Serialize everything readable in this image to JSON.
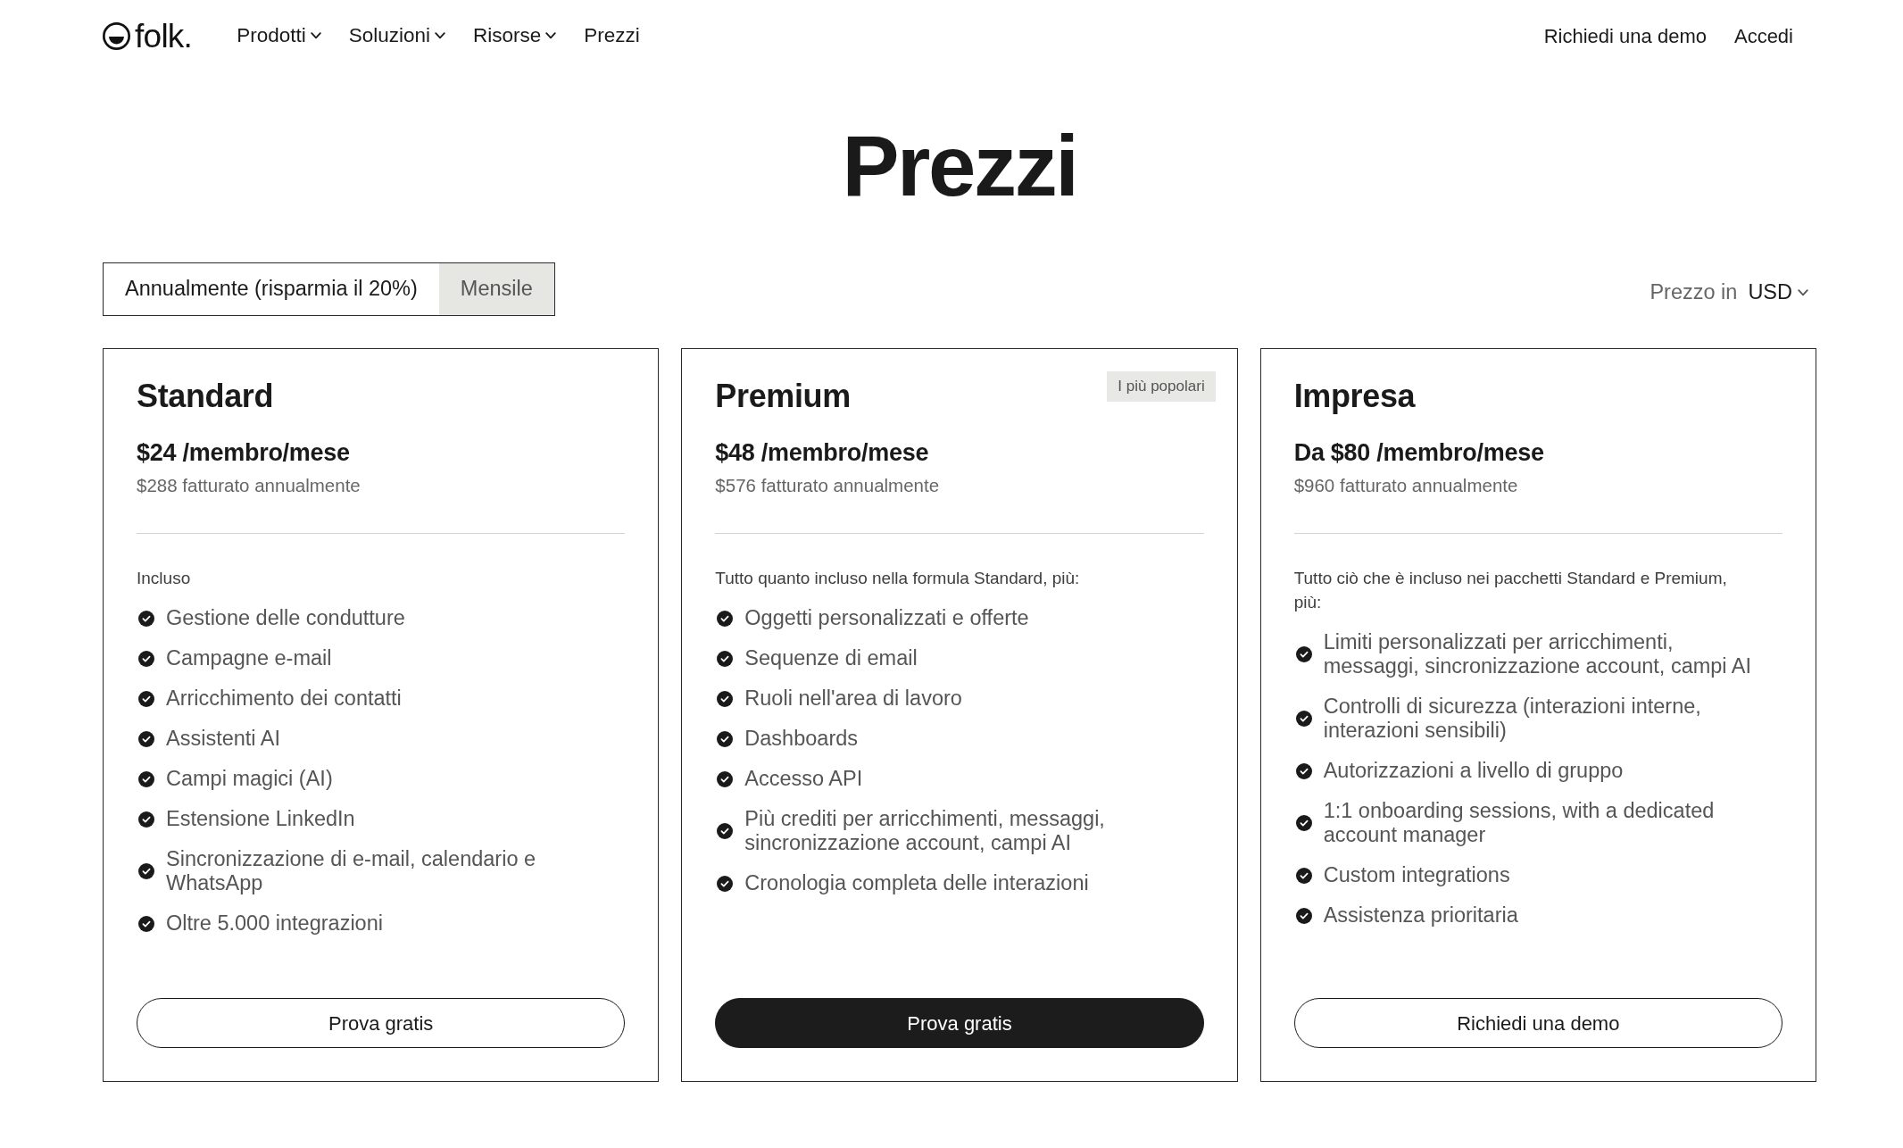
{
  "header": {
    "logo": "folk.",
    "nav": [
      {
        "label": "Prodotti",
        "dropdown": true
      },
      {
        "label": "Soluzioni",
        "dropdown": true
      },
      {
        "label": "Risorse",
        "dropdown": true
      },
      {
        "label": "Prezzi",
        "dropdown": false
      }
    ],
    "actions": [
      "Richiedi una demo",
      "Accedi"
    ]
  },
  "title": "Prezzi",
  "billing_toggle": [
    {
      "label": "Annualmente (risparmia il 20%)",
      "selected": true
    },
    {
      "label": "Mensile",
      "selected": false
    }
  ],
  "currency": {
    "label": "Prezzo in",
    "value": "USD"
  },
  "plans": [
    {
      "name": "Standard",
      "price": "$24 /membro/mese",
      "billed": "$288 fatturato annualmente",
      "intro": "Incluso",
      "features": [
        "Gestione delle condutture",
        "Campagne e-mail",
        "Arricchimento dei contatti",
        "Assistenti AI",
        "Campi magici (AI)",
        "Estensione LinkedIn",
        "Sincronizzazione di e-mail, calendario e WhatsApp",
        "Oltre 5.000 integrazioni"
      ],
      "button": {
        "label": "Prova gratis",
        "kind": "outline"
      }
    },
    {
      "name": "Premium",
      "badge": "I più popolari",
      "price": "$48 /membro/mese",
      "billed": "$576 fatturato annualmente",
      "intro": "Tutto quanto incluso nella formula Standard, più:",
      "features": [
        "Oggetti personalizzati e offerte",
        "Sequenze di email",
        "Ruoli nell'area di lavoro",
        "Dashboards",
        "Accesso API",
        "Più crediti per arricchimenti, messaggi, sincronizzazione account, campi AI",
        "Cronologia completa delle interazioni"
      ],
      "button": {
        "label": "Prova gratis",
        "kind": "filled"
      }
    },
    {
      "name": "Impresa",
      "price": "Da $80 /membro/mese",
      "billed": "$960 fatturato annualmente",
      "intro": "Tutto ciò che è incluso nei pacchetti Standard e Premium, più:",
      "features": [
        "Limiti personalizzati per arricchimenti, messaggi, sincronizzazione account, campi AI",
        "Controlli di sicurezza (interazioni interne, interazioni sensibili)",
        "Autorizzazioni a livello di gruppo",
        "1:1 onboarding sessions, with a dedicated account manager",
        "Custom integrations",
        "Assistenza prioritaria"
      ],
      "button": {
        "label": "Richiedi una demo",
        "kind": "outline"
      }
    }
  ]
}
